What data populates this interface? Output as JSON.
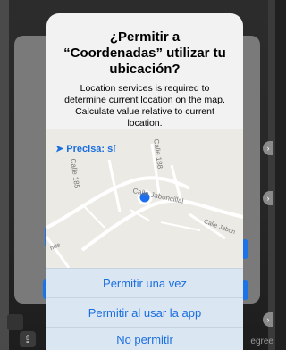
{
  "alert": {
    "title": "¿Permitir a “Coordenadas” utilizar tu ubicación?",
    "message": "Location services is required to determine current location on the map. Calculate value relative to current location.",
    "precise_label": "Precisa: sí",
    "buttons": {
      "allow_once": "Permitir una vez",
      "allow_while_using": "Permitir al usar la app",
      "deny": "No permitir"
    }
  },
  "map": {
    "street_labels": {
      "calle_188": "Calle 188",
      "calle_185": "Calle 185",
      "calle_jaboncillal": "Calle Jaboncillal",
      "calle_jabon": "Calle Jabon",
      "edge_label": "nde"
    },
    "colors": {
      "location_dot": "#1e6ef0",
      "accent": "#1a6fe0"
    }
  },
  "background": {
    "bottom_right_text": "egree",
    "share_icon": "share-icon"
  }
}
